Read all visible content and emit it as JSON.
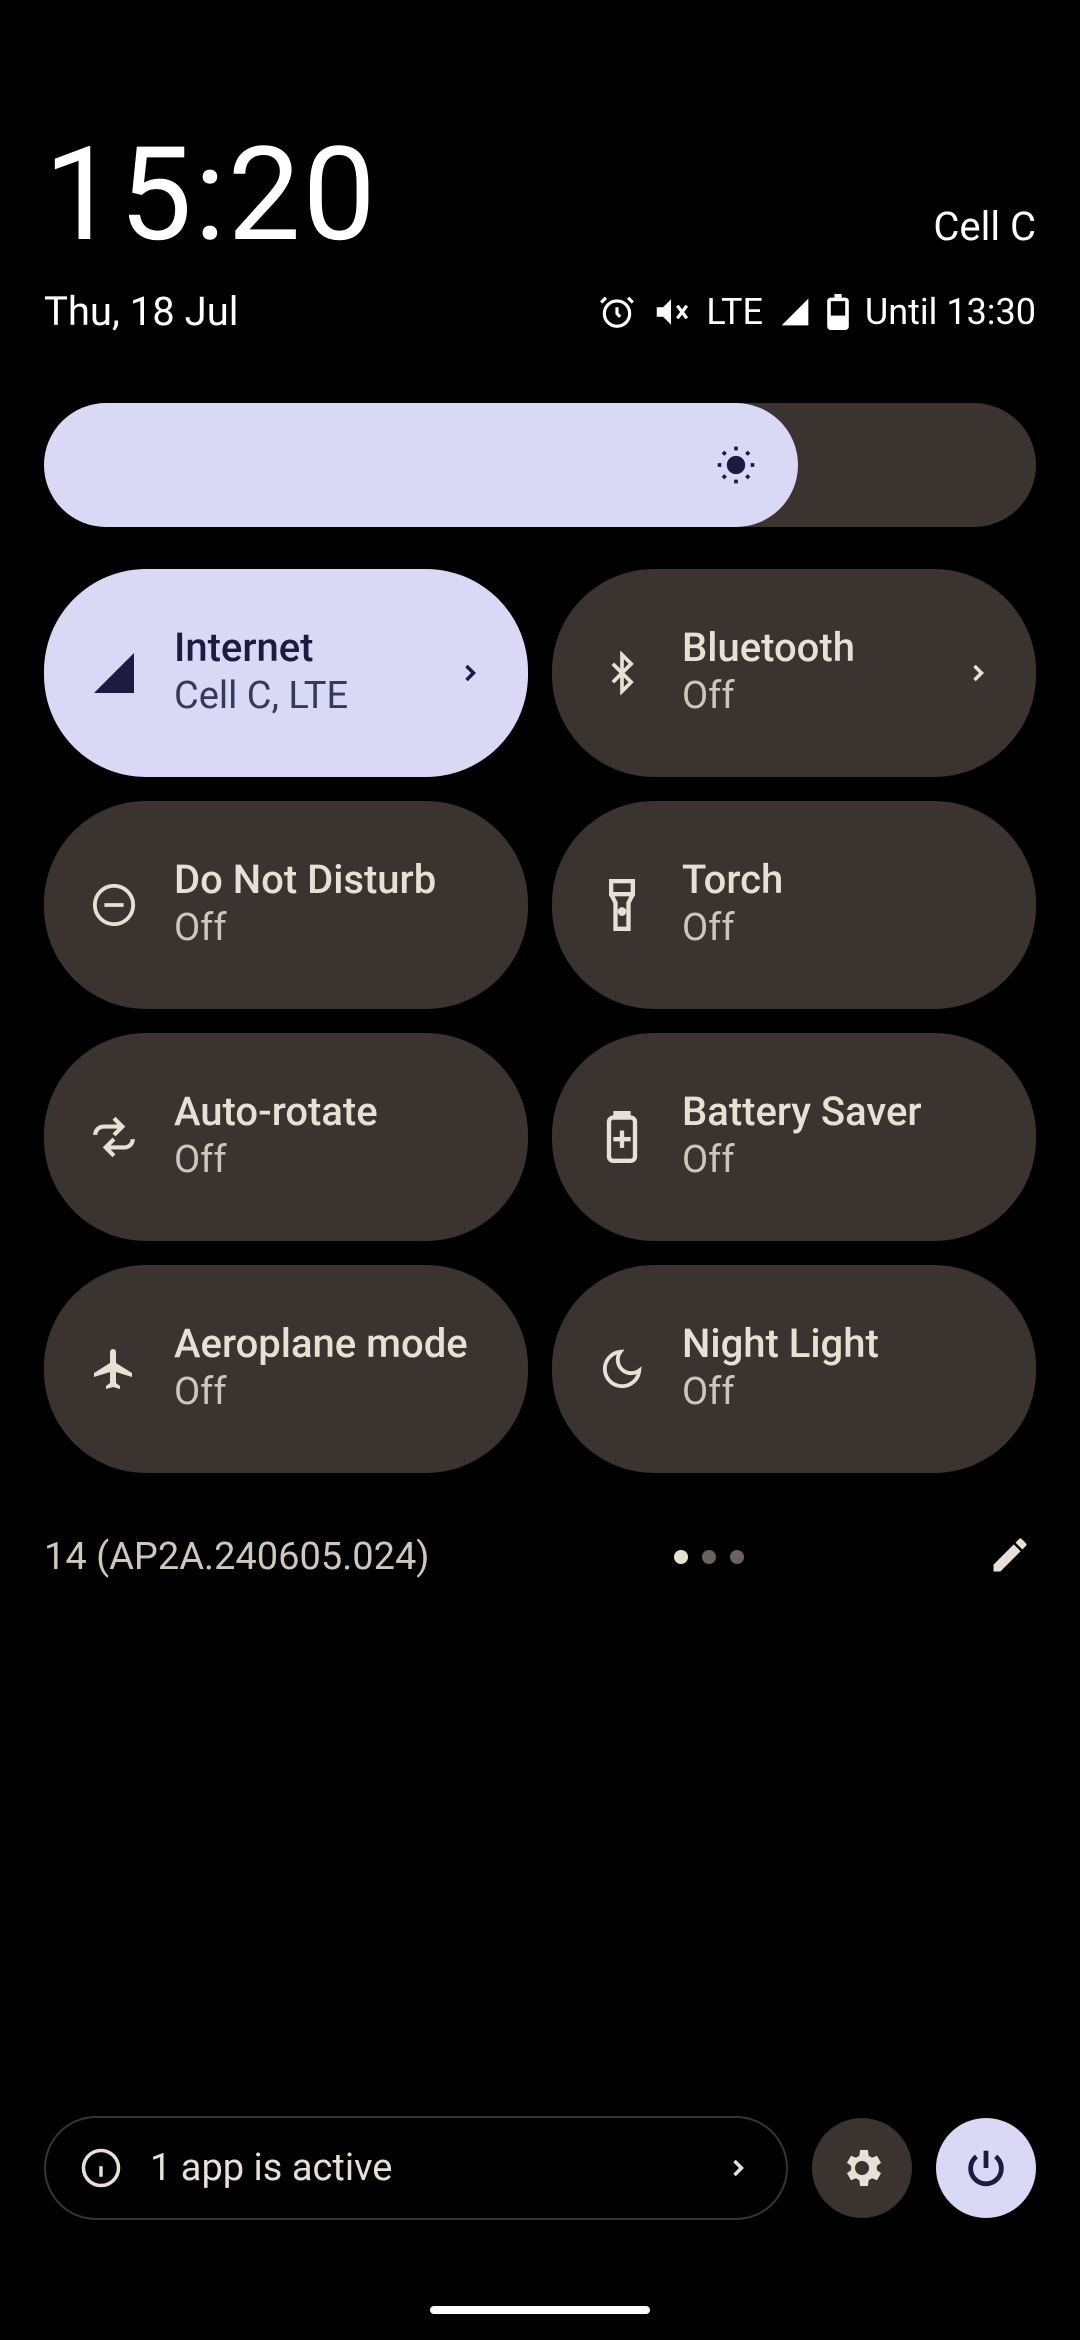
{
  "header": {
    "time": "15:20",
    "date": "Thu, 18 Jul",
    "carrier": "Cell C",
    "network_type": "LTE",
    "battery_text": "Until 13:30"
  },
  "brightness": {
    "level_percent": 76
  },
  "tiles": [
    {
      "id": "internet",
      "title": "Internet",
      "subtitle": "Cell C, LTE",
      "active": true,
      "has_chevron": true
    },
    {
      "id": "bluetooth",
      "title": "Bluetooth",
      "subtitle": "Off",
      "active": false,
      "has_chevron": true
    },
    {
      "id": "dnd",
      "title": "Do Not Disturb",
      "subtitle": "Off",
      "active": false,
      "has_chevron": false
    },
    {
      "id": "torch",
      "title": "Torch",
      "subtitle": "Off",
      "active": false,
      "has_chevron": false
    },
    {
      "id": "autorotate",
      "title": "Auto-rotate",
      "subtitle": "Off",
      "active": false,
      "has_chevron": false
    },
    {
      "id": "battery",
      "title": "Battery Saver",
      "subtitle": "Off",
      "active": false,
      "has_chevron": false
    },
    {
      "id": "airplane",
      "title": "Aeroplane mode",
      "subtitle": "Off",
      "active": false,
      "has_chevron": false
    },
    {
      "id": "nightlight",
      "title": "Night Light",
      "subtitle": "Off",
      "active": false,
      "has_chevron": false
    }
  ],
  "footer": {
    "build": "14 (AP2A.240605.024)",
    "page_count": 3,
    "page_index": 0
  },
  "bottom": {
    "active_apps_text": "1 app is active"
  },
  "colors": {
    "accent_light": "#d9d8f5",
    "accent_dark": "#1d1b42",
    "tile_bg": "#3a332f",
    "text": "#e8e0d5"
  }
}
